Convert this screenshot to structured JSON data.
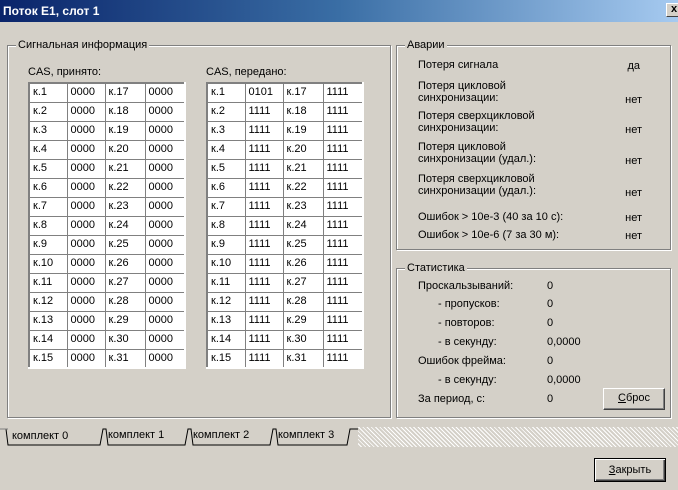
{
  "window": {
    "title": "Поток E1, слот 1",
    "close_glyph": "x"
  },
  "signal_info": {
    "legend": "Сигнальная информация",
    "received_label": "CAS, принято:",
    "transmitted_label": "CAS, передано:",
    "received_rows": [
      [
        "к.1",
        "0000",
        "к.17",
        "0000"
      ],
      [
        "к.2",
        "0000",
        "к.18",
        "0000"
      ],
      [
        "к.3",
        "0000",
        "к.19",
        "0000"
      ],
      [
        "к.4",
        "0000",
        "к.20",
        "0000"
      ],
      [
        "к.5",
        "0000",
        "к.21",
        "0000"
      ],
      [
        "к.6",
        "0000",
        "к.22",
        "0000"
      ],
      [
        "к.7",
        "0000",
        "к.23",
        "0000"
      ],
      [
        "к.8",
        "0000",
        "к.24",
        "0000"
      ],
      [
        "к.9",
        "0000",
        "к.25",
        "0000"
      ],
      [
        "к.10",
        "0000",
        "к.26",
        "0000"
      ],
      [
        "к.11",
        "0000",
        "к.27",
        "0000"
      ],
      [
        "к.12",
        "0000",
        "к.28",
        "0000"
      ],
      [
        "к.13",
        "0000",
        "к.29",
        "0000"
      ],
      [
        "к.14",
        "0000",
        "к.30",
        "0000"
      ],
      [
        "к.15",
        "0000",
        "к.31",
        "0000"
      ]
    ],
    "transmitted_rows": [
      [
        "к.1",
        "0101",
        "к.17",
        "1111"
      ],
      [
        "к.2",
        "1111",
        "к.18",
        "1111"
      ],
      [
        "к.3",
        "1111",
        "к.19",
        "1111"
      ],
      [
        "к.4",
        "1111",
        "к.20",
        "1111"
      ],
      [
        "к.5",
        "1111",
        "к.21",
        "1111"
      ],
      [
        "к.6",
        "1111",
        "к.22",
        "1111"
      ],
      [
        "к.7",
        "1111",
        "к.23",
        "1111"
      ],
      [
        "к.8",
        "1111",
        "к.24",
        "1111"
      ],
      [
        "к.9",
        "1111",
        "к.25",
        "1111"
      ],
      [
        "к.10",
        "1111",
        "к.26",
        "1111"
      ],
      [
        "к.11",
        "1111",
        "к.27",
        "1111"
      ],
      [
        "к.12",
        "1111",
        "к.28",
        "1111"
      ],
      [
        "к.13",
        "1111",
        "к.29",
        "1111"
      ],
      [
        "к.14",
        "1111",
        "к.30",
        "1111"
      ],
      [
        "к.15",
        "1111",
        "к.31",
        "1111"
      ]
    ]
  },
  "alarms": {
    "legend": "Аварии",
    "items": [
      {
        "label": "Потеря сигнала",
        "value": "да"
      },
      {
        "label": "Потеря цикловой\nсинхронизации:",
        "value": "нет"
      },
      {
        "label": "Потеря сверхцикловой\nсинхронизации:",
        "value": "нет"
      },
      {
        "label": "Потеря цикловой\nсинхронизации (удал.):",
        "value": "нет"
      },
      {
        "label": "Потеря сверхцикловой\nсинхронизации (удал.):",
        "value": "нет"
      },
      {
        "label": "Ошибок > 10e-3 (40 за 10 с):",
        "value": "нет"
      },
      {
        "label": "Ошибок > 10e-6 (7 за 30 м):",
        "value": "нет"
      }
    ]
  },
  "statistics": {
    "legend": "Статистика",
    "items": [
      {
        "label": "Проскальзываний:",
        "value": "0"
      },
      {
        "label": "- пропусков:",
        "value": "0"
      },
      {
        "label": "- повторов:",
        "value": "0"
      },
      {
        "label": "- в секунду:",
        "value": "0,0000"
      },
      {
        "label": "Ошибок фрейма:",
        "value": "0"
      },
      {
        "label": "- в секунду:",
        "value": "0,0000"
      },
      {
        "label": "За период, с:",
        "value": "0"
      }
    ],
    "reset_button": {
      "accel": "С",
      "rest": "брос"
    }
  },
  "tabs": [
    "комплект 0",
    "комплект 1",
    "комплект 2",
    "комплект 3"
  ],
  "close_button": {
    "accel": "З",
    "rest": "акрыть"
  }
}
